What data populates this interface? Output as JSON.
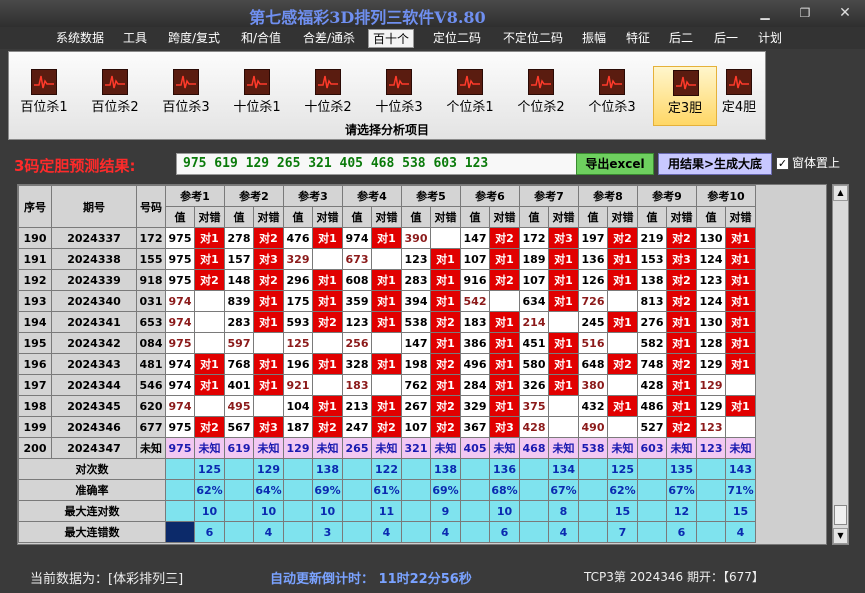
{
  "app": {
    "title": "第七感福彩3D排列三软件V8.80"
  },
  "menu": [
    "系统数据",
    "工具",
    "跨度/复式",
    "和/合值",
    "合差/通杀",
    "百十个",
    "定位二码",
    "不定位二码",
    "振幅",
    "特征",
    "后二",
    "后一",
    "计划"
  ],
  "ribbon": {
    "buttons": [
      "百位杀1",
      "百位杀2",
      "百位杀3",
      "十位杀1",
      "十位杀2",
      "十位杀3",
      "个位杀1",
      "个位杀2",
      "个位杀3",
      "定3胆",
      "定4胆"
    ],
    "caption": "请选择分析项目"
  },
  "result": {
    "label": "3码定胆预测结果:",
    "value": "975 619 129 265 321 405 468 538 603 123",
    "export_label": "导出excel",
    "generate_label": "用结果>生成大底",
    "on_top_label": "窗体置上",
    "on_top_checked": "✓"
  },
  "table": {
    "headers": {
      "seq": "序号",
      "issue": "期号",
      "code": "号码",
      "val": "值",
      "judge": "对错"
    },
    "refs": [
      "参考1",
      "参考2",
      "参考3",
      "参考4",
      "参考5",
      "参考6",
      "参考7",
      "参考8",
      "参考9",
      "参考10"
    ],
    "rows": [
      {
        "seq": "190",
        "issue": "2024337",
        "code": "172",
        "cells": [
          [
            "975",
            "对1"
          ],
          [
            "278",
            "对2"
          ],
          [
            "476",
            "对1"
          ],
          [
            "974",
            "对1"
          ],
          [
            "390",
            ""
          ],
          [
            "147",
            "对2"
          ],
          [
            "172",
            "对3"
          ],
          [
            "197",
            "对2"
          ],
          [
            "219",
            "对2"
          ],
          [
            "130",
            "对1"
          ]
        ]
      },
      {
        "seq": "191",
        "issue": "2024338",
        "code": "155",
        "cells": [
          [
            "975",
            "对1"
          ],
          [
            "157",
            "对3"
          ],
          [
            "329",
            ""
          ],
          [
            "673",
            ""
          ],
          [
            "123",
            "对1"
          ],
          [
            "107",
            "对1"
          ],
          [
            "189",
            "对1"
          ],
          [
            "136",
            "对1"
          ],
          [
            "153",
            "对3"
          ],
          [
            "124",
            "对1"
          ]
        ]
      },
      {
        "seq": "192",
        "issue": "2024339",
        "code": "918",
        "cells": [
          [
            "975",
            "对2"
          ],
          [
            "148",
            "对2"
          ],
          [
            "296",
            "对1"
          ],
          [
            "608",
            "对1"
          ],
          [
            "283",
            "对1"
          ],
          [
            "916",
            "对2"
          ],
          [
            "107",
            "对1"
          ],
          [
            "126",
            "对1"
          ],
          [
            "138",
            "对2"
          ],
          [
            "123",
            "对1"
          ]
        ]
      },
      {
        "seq": "193",
        "issue": "2024340",
        "code": "031",
        "cells": [
          [
            "974",
            ""
          ],
          [
            "839",
            "对1"
          ],
          [
            "175",
            "对1"
          ],
          [
            "359",
            "对1"
          ],
          [
            "394",
            "对1"
          ],
          [
            "542",
            ""
          ],
          [
            "634",
            "对1"
          ],
          [
            "726",
            ""
          ],
          [
            "813",
            "对2"
          ],
          [
            "124",
            "对1"
          ]
        ]
      },
      {
        "seq": "194",
        "issue": "2024341",
        "code": "653",
        "cells": [
          [
            "974",
            ""
          ],
          [
            "283",
            "对1"
          ],
          [
            "593",
            "对2"
          ],
          [
            "123",
            "对1"
          ],
          [
            "538",
            "对2"
          ],
          [
            "183",
            "对1"
          ],
          [
            "214",
            ""
          ],
          [
            "245",
            "对1"
          ],
          [
            "276",
            "对1"
          ],
          [
            "130",
            "对1"
          ]
        ]
      },
      {
        "seq": "195",
        "issue": "2024342",
        "code": "084",
        "cells": [
          [
            "975",
            ""
          ],
          [
            "597",
            ""
          ],
          [
            "125",
            ""
          ],
          [
            "256",
            ""
          ],
          [
            "147",
            "对1"
          ],
          [
            "386",
            "对1"
          ],
          [
            "451",
            "对1"
          ],
          [
            "516",
            ""
          ],
          [
            "582",
            "对1"
          ],
          [
            "128",
            "对1"
          ]
        ]
      },
      {
        "seq": "196",
        "issue": "2024343",
        "code": "481",
        "cells": [
          [
            "974",
            "对1"
          ],
          [
            "768",
            "对1"
          ],
          [
            "196",
            "对1"
          ],
          [
            "328",
            "对1"
          ],
          [
            "198",
            "对2"
          ],
          [
            "496",
            "对1"
          ],
          [
            "580",
            "对1"
          ],
          [
            "648",
            "对2"
          ],
          [
            "748",
            "对2"
          ],
          [
            "129",
            "对1"
          ]
        ]
      },
      {
        "seq": "197",
        "issue": "2024344",
        "code": "546",
        "cells": [
          [
            "974",
            "对1"
          ],
          [
            "401",
            "对1"
          ],
          [
            "921",
            ""
          ],
          [
            "183",
            ""
          ],
          [
            "762",
            "对1"
          ],
          [
            "284",
            "对1"
          ],
          [
            "326",
            "对1"
          ],
          [
            "380",
            ""
          ],
          [
            "428",
            "对1"
          ],
          [
            "129",
            ""
          ]
        ]
      },
      {
        "seq": "198",
        "issue": "2024345",
        "code": "620",
        "cells": [
          [
            "974",
            ""
          ],
          [
            "495",
            ""
          ],
          [
            "104",
            "对1"
          ],
          [
            "213",
            "对1"
          ],
          [
            "267",
            "对2"
          ],
          [
            "329",
            "对1"
          ],
          [
            "375",
            ""
          ],
          [
            "432",
            "对1"
          ],
          [
            "486",
            "对1"
          ],
          [
            "129",
            "对1"
          ]
        ]
      },
      {
        "seq": "199",
        "issue": "2024346",
        "code": "677",
        "cells": [
          [
            "975",
            "对2"
          ],
          [
            "567",
            "对3"
          ],
          [
            "187",
            "对2"
          ],
          [
            "247",
            "对2"
          ],
          [
            "107",
            "对2"
          ],
          [
            "367",
            "对3"
          ],
          [
            "428",
            ""
          ],
          [
            "490",
            ""
          ],
          [
            "527",
            "对2"
          ],
          [
            "123",
            ""
          ]
        ]
      }
    ],
    "predict": {
      "seq": "200",
      "issue": "2024347",
      "code": "未知",
      "cells": [
        [
          "975",
          "未知"
        ],
        [
          "619",
          "未知"
        ],
        [
          "129",
          "未知"
        ],
        [
          "265",
          "未知"
        ],
        [
          "321",
          "未知"
        ],
        [
          "405",
          "未知"
        ],
        [
          "468",
          "未知"
        ],
        [
          "538",
          "未知"
        ],
        [
          "603",
          "未知"
        ],
        [
          "123",
          "未知"
        ]
      ]
    },
    "stats": [
      {
        "label": "对次数",
        "values": [
          "125",
          "129",
          "138",
          "122",
          "138",
          "136",
          "134",
          "125",
          "135",
          "143"
        ]
      },
      {
        "label": "准确率",
        "values": [
          "62%",
          "64%",
          "69%",
          "61%",
          "69%",
          "68%",
          "67%",
          "62%",
          "67%",
          "71%"
        ]
      },
      {
        "label": "最大连对数",
        "values": [
          "10",
          "10",
          "10",
          "11",
          "9",
          "10",
          "8",
          "15",
          "12",
          "15"
        ]
      },
      {
        "label": "最大连错数",
        "values": [
          "6",
          "4",
          "3",
          "4",
          "4",
          "6",
          "4",
          "7",
          "6",
          "4"
        ]
      }
    ]
  },
  "status": {
    "data_source": "当前数据为：[体彩排列三]",
    "countdown": "自动更新倒计时：  11时22分56秒",
    "draw_info": "TCP3第 2024346 期开：【677】"
  }
}
